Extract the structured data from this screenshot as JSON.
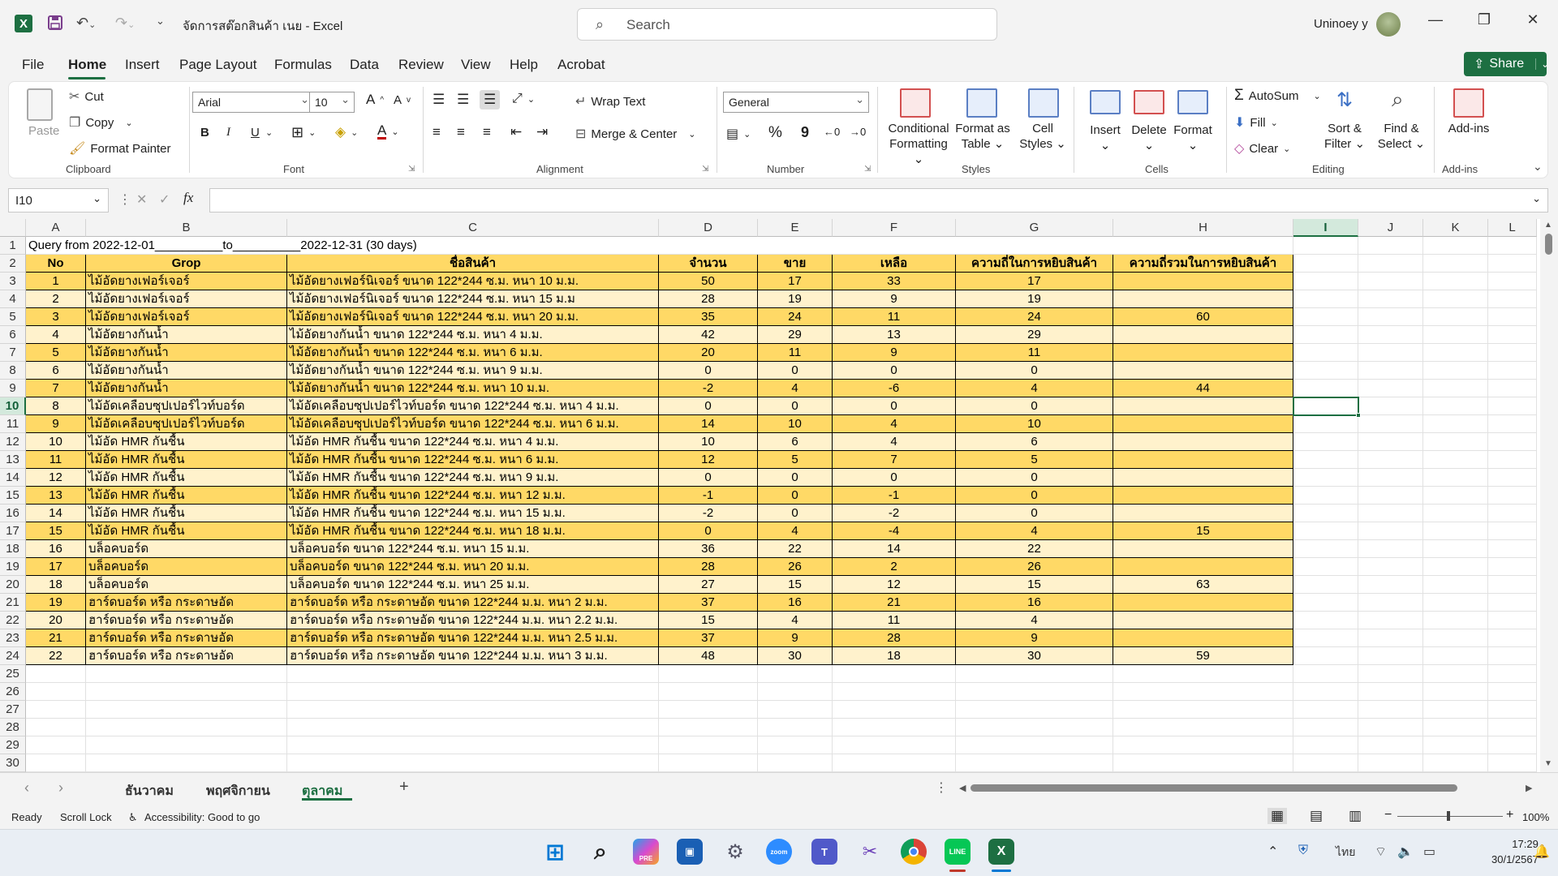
{
  "titlebar": {
    "app_logo": "X",
    "doc_title": "จัดการสต๊อกสินค้า เนย  -  Excel",
    "search_placeholder": "Search",
    "user_name": "Uninoey y",
    "min_glyph": "—",
    "max_glyph": "❐",
    "close_glyph": "✕"
  },
  "menu": {
    "tabs": [
      "File",
      "Home",
      "Insert",
      "Page Layout",
      "Formulas",
      "Data",
      "Review",
      "View",
      "Help",
      "Acrobat"
    ],
    "active": "Home",
    "share_label": "Share"
  },
  "ribbon": {
    "clipboard": {
      "paste": "Paste",
      "cut": "Cut",
      "copy": "Copy",
      "format_painter": "Format Painter",
      "label": "Clipboard"
    },
    "font": {
      "name": "Arial",
      "size": "10",
      "bold": "B",
      "italic": "I",
      "underline": "U",
      "label": "Font"
    },
    "alignment": {
      "wrap_text": "Wrap Text",
      "merge_center": "Merge & Center",
      "label": "Alignment"
    },
    "number": {
      "format": "General",
      "percent": "%",
      "comma": "9",
      "label": "Number"
    },
    "styles": {
      "conditional_1": "Conditional",
      "conditional_2": "Formatting ⌄",
      "format_table_1": "Format as",
      "format_table_2": "Table ⌄",
      "cell_styles_1": "Cell",
      "cell_styles_2": "Styles ⌄",
      "label": "Styles"
    },
    "cells": {
      "insert": "Insert",
      "delete": "Delete",
      "format": "Format",
      "label": "Cells"
    },
    "editing": {
      "autosum": "AutoSum",
      "fill": "Fill",
      "clear": "Clear",
      "sort_1": "Sort &",
      "sort_2": "Filter ⌄",
      "find_1": "Find &",
      "find_2": "Select ⌄",
      "label": "Editing"
    },
    "addins": {
      "label_btn": "Add-ins",
      "label": "Add-ins"
    }
  },
  "formula_bar": {
    "name_box": "I10",
    "fx": "fx",
    "content": ""
  },
  "sheet": {
    "columns": [
      "A",
      "B",
      "C",
      "D",
      "E",
      "F",
      "G",
      "H",
      "I",
      "J",
      "K",
      "L"
    ],
    "selected_col": "I",
    "selected_row": 10,
    "query_line": "Query from 2022-12-01__________to__________2022-12-31  (30 days)",
    "headers": [
      "No",
      "Grop",
      "ชื่อสินค้า",
      "จำนวน",
      "ขาย",
      "เหลือ",
      "ความถี่ในการหยิบสินค้า",
      "ความถี่รวมในการหยิบสินค้า"
    ],
    "rows": [
      [
        "1",
        "ไม้อัดยางเฟอร์เจอร์",
        "ไม้อัดยางเฟอร์นิเจอร์ ขนาด 122*244 ซ.ม. หนา 10 ม.ม.",
        "50",
        "17",
        "33",
        "17",
        ""
      ],
      [
        "2",
        "ไม้อัดยางเฟอร์เจอร์",
        "ไม้อัดยางเฟอร์นิเจอร์ ขนาด 122*244 ซ.ม. หนา 15 ม.ม",
        "28",
        "19",
        "9",
        "19",
        ""
      ],
      [
        "3",
        "ไม้อัดยางเฟอร์เจอร์",
        "ไม้อัดยางเฟอร์นิเจอร์ ขนาด 122*244 ซ.ม. หนา 20 ม.ม.",
        "35",
        "24",
        "11",
        "24",
        "60"
      ],
      [
        "4",
        "ไม้อัดยางกันน้ำ",
        "ไม้อัดยางกันน้ำ ขนาด 122*244 ซ.ม. หนา 4 ม.ม.",
        "42",
        "29",
        "13",
        "29",
        ""
      ],
      [
        "5",
        "ไม้อัดยางกันน้ำ",
        "ไม้อัดยางกันน้ำ ขนาด 122*244 ซ.ม. หนา 6 ม.ม.",
        "20",
        "11",
        "9",
        "11",
        ""
      ],
      [
        "6",
        "ไม้อัดยางกันน้ำ",
        "ไม้อัดยางกันน้ำ ขนาด 122*244 ซ.ม. หนา 9 ม.ม.",
        "0",
        "0",
        "0",
        "0",
        ""
      ],
      [
        "7",
        "ไม้อัดยางกันน้ำ",
        "ไม้อัดยางกันน้ำ ขนาด 122*244 ซ.ม. หนา 10 ม.ม.",
        "-2",
        "4",
        "-6",
        "4",
        "44"
      ],
      [
        "8",
        "ไม้อัดเคลือบซุปเปอร์ไวท์บอร์ด",
        "ไม้อัดเคลือบซุปเปอร์ไวท์บอร์ด ขนาด 122*244 ซ.ม. หนา 4 ม.ม.",
        "0",
        "0",
        "0",
        "0",
        ""
      ],
      [
        "9",
        "ไม้อัดเคลือบซุปเปอร์ไวท์บอร์ด",
        "ไม้อัดเคลือบซุปเปอร์ไวท์บอร์ด ขนาด 122*244 ซ.ม. หนา 6 ม.ม.",
        "14",
        "10",
        "4",
        "10",
        ""
      ],
      [
        "10",
        "ไม้อัด HMR กันชื้น",
        "ไม้อัด HMR กันชื้น ขนาด 122*244 ซ.ม. หนา 4 ม.ม.",
        "10",
        "6",
        "4",
        "6",
        ""
      ],
      [
        "11",
        "ไม้อัด HMR กันชื้น",
        "ไม้อัด HMR กันชื้น ขนาด 122*244 ซ.ม. หนา 6 ม.ม.",
        "12",
        "5",
        "7",
        "5",
        ""
      ],
      [
        "12",
        "ไม้อัด HMR กันชื้น",
        "ไม้อัด HMR กันชื้น ขนาด 122*244 ซ.ม. หนา 9 ม.ม.",
        "0",
        "0",
        "0",
        "0",
        ""
      ],
      [
        "13",
        "ไม้อัด HMR กันชื้น",
        "ไม้อัด HMR กันชื้น ขนาด 122*244 ซ.ม. หนา 12 ม.ม.",
        "-1",
        "0",
        "-1",
        "0",
        ""
      ],
      [
        "14",
        "ไม้อัด HMR กันชื้น",
        "ไม้อัด HMR กันชื้น ขนาด 122*244 ซ.ม. หนา 15 ม.ม.",
        "-2",
        "0",
        "-2",
        "0",
        ""
      ],
      [
        "15",
        "ไม้อัด HMR กันชื้น",
        "ไม้อัด HMR กันชื้น ขนาด 122*244 ซ.ม. หนา 18 ม.ม.",
        "0",
        "4",
        "-4",
        "4",
        "15"
      ],
      [
        "16",
        "บล็อคบอร์ด",
        "บล็อคบอร์ด ขนาด 122*244 ซ.ม. หนา 15 ม.ม.",
        "36",
        "22",
        "14",
        "22",
        ""
      ],
      [
        "17",
        "บล็อคบอร์ด",
        "บล็อคบอร์ด ขนาด 122*244 ซ.ม. หนา 20 ม.ม.",
        "28",
        "26",
        "2",
        "26",
        ""
      ],
      [
        "18",
        "บล็อคบอร์ด",
        "บล็อคบอร์ด ขนาด 122*244 ซ.ม. หนา 25 ม.ม.",
        "27",
        "15",
        "12",
        "15",
        "63"
      ],
      [
        "19",
        "ฮาร์ดบอร์ด หรือ กระดาษอัด",
        "ฮาร์ดบอร์ด หรือ กระดาษอัด ขนาด 122*244 ม.ม. หนา 2 ม.ม.",
        "37",
        "16",
        "21",
        "16",
        ""
      ],
      [
        "20",
        "ฮาร์ดบอร์ด หรือ กระดาษอัด",
        "ฮาร์ดบอร์ด หรือ กระดาษอัด ขนาด 122*244 ม.ม. หนา 2.2 ม.ม.",
        "15",
        "4",
        "11",
        "4",
        ""
      ],
      [
        "21",
        "ฮาร์ดบอร์ด หรือ กระดาษอัด",
        "ฮาร์ดบอร์ด หรือ กระดาษอัด ขนาด 122*244 ม.ม. หนา 2.5 ม.ม.",
        "37",
        "9",
        "28",
        "9",
        ""
      ],
      [
        "22",
        "ฮาร์ดบอร์ด หรือ กระดาษอัด",
        "ฮาร์ดบอร์ด หรือ กระดาษอัด ขนาด 122*244 ม.ม. หนา 3 ม.ม.",
        "48",
        "30",
        "18",
        "30",
        "59"
      ]
    ],
    "row_numbers": [
      "1",
      "2",
      "3",
      "4",
      "5",
      "6",
      "7",
      "8",
      "9",
      "10",
      "11",
      "12",
      "13",
      "14",
      "15",
      "16",
      "17",
      "18",
      "19",
      "20",
      "21",
      "22",
      "23",
      "24",
      "25",
      "26",
      "27",
      "28",
      "29",
      "30"
    ]
  },
  "sheet_tabs": {
    "tabs": [
      "ธันวาคม",
      "พฤศจิกายน",
      "ตุลาคม"
    ],
    "active": "ตุลาคม",
    "add": "+"
  },
  "status": {
    "ready": "Ready",
    "scroll_lock": "Scroll Lock",
    "accessibility": "Accessibility: Good to go",
    "zoom": "100%"
  },
  "taskbar": {
    "time": "17:29",
    "date": "30/1/2567",
    "lang": "ไทย",
    "zoom_app": "zoom",
    "line_app": "LINE",
    "copilot_badge": "PRE"
  },
  "colors": {
    "accent": "#1d6f42",
    "header_fill": "#ffd966",
    "row_dark": "#ffd966",
    "row_light": "#fff2cc"
  }
}
